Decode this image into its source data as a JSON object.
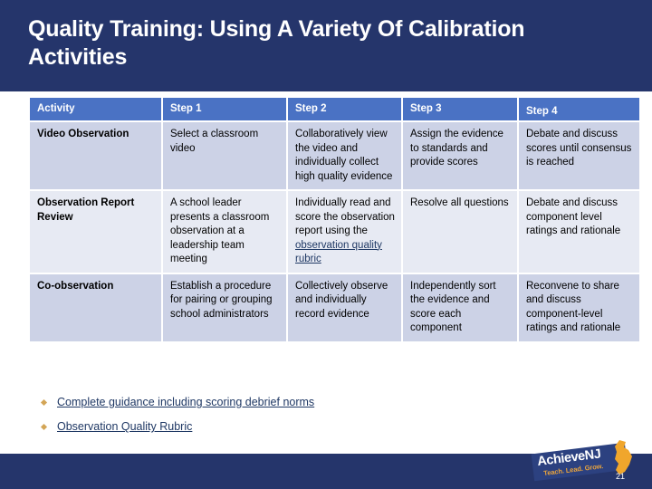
{
  "slide": {
    "title": "Quality Training: Using A Variety Of Calibration Activities",
    "slide_number": "21",
    "colors": {
      "banner_navy": "#25356b",
      "header_blue": "#4a72c4",
      "row_shade": "#ccd2e6",
      "row_light": "#e7eaf3",
      "link_navy": "#1f3864",
      "bullet_tan": "#d3a556",
      "logo_orange": "#e8a33d"
    }
  },
  "table": {
    "headers": [
      "Activity",
      "Step 1",
      "Step 2",
      "Step 3",
      "Step 4"
    ],
    "rows": [
      {
        "activity": "Video Observation",
        "step1": "Select a classroom video",
        "step2": "Collaboratively view the video and individually collect high quality evidence",
        "step3": "Assign the evidence to standards and provide scores",
        "step4": "Debate and discuss scores until consensus is reached"
      },
      {
        "activity": "Observation Report Review",
        "step1": "A school leader presents a classroom observation at a leadership team meeting",
        "step2_prefix": "Individually read and score the observation report using the ",
        "step2_link": "observation quality rubric",
        "step3": "Resolve all questions",
        "step4": "Debate and discuss component level ratings and rationale"
      },
      {
        "activity": "Co-observation",
        "step1": "Establish a procedure for pairing or grouping school administrators",
        "step2": "Collectively observe  and individually record evidence",
        "step3": "Independently sort the evidence and score each component",
        "step4": "Reconvene to share and discuss component-level ratings and rationale"
      }
    ]
  },
  "bullets": [
    {
      "label": "Complete guidance including scoring debrief norms"
    },
    {
      "label": "Observation Quality Rubric"
    }
  ],
  "logo": {
    "wordmark": "AchieveNJ",
    "tagline": "Teach. Lead. Grow."
  }
}
